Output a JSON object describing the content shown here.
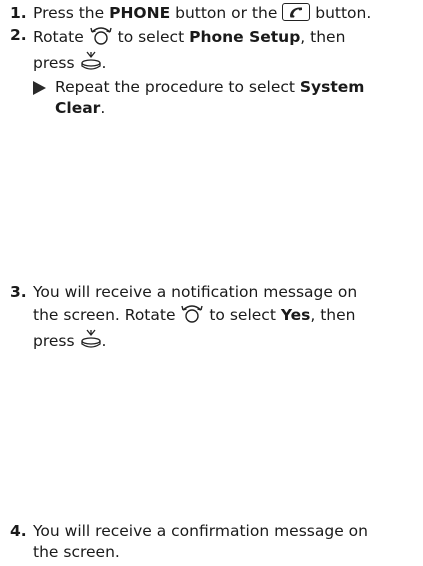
{
  "fragment": "",
  "steps": [
    {
      "number": "1.",
      "parts": [
        "Press the ",
        "PHONE",
        " button or the ",
        " button."
      ]
    },
    {
      "number": "2.",
      "line1_a": "Rotate ",
      "line1_b": " to select ",
      "line1_bold": "Phone Setup",
      "line1_c": ", then",
      "line2": "press ",
      "line2_end": ".",
      "sub_a": "Repeat the procedure to select ",
      "sub_bold": "System Clear",
      "sub_end": "."
    },
    {
      "number": "3.",
      "line1": "You will receive a notification message on",
      "line2_a": "the screen. Rotate ",
      "line2_b": " to select ",
      "line2_bold": "Yes",
      "line2_c": ", then",
      "line3": "press ",
      "line3_end": "."
    },
    {
      "number": "4.",
      "line1": "You will receive a confirmation message on",
      "line2": "the screen."
    }
  ],
  "icons": {
    "phone_button": "phone-handset-button-icon",
    "rotate_knob": "interface-dial-rotate-icon",
    "press_knob": "interface-dial-press-icon"
  }
}
